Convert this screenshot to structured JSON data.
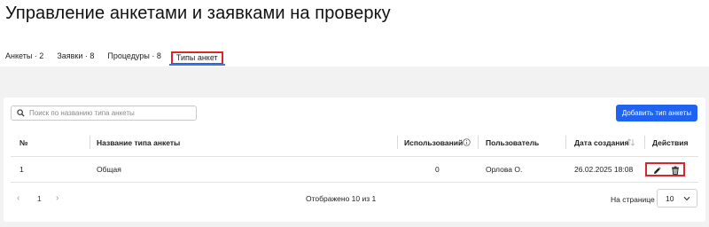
{
  "page": {
    "title": "Управление анкетами и заявками на проверку"
  },
  "tabs": [
    {
      "label": "Анкеты · 2",
      "active": false
    },
    {
      "label": "Заявки · 8",
      "active": false
    },
    {
      "label": "Процедуры · 8",
      "active": false
    },
    {
      "label": "Типы анкет",
      "active": true
    }
  ],
  "toolbar": {
    "search_placeholder": "Поиск по названию типа анкеты",
    "search_value": "",
    "add_button_label": "Добавить тип анкеты"
  },
  "table": {
    "columns": [
      "№",
      "Название типа анкеты",
      "Использований",
      "Пользователь",
      "Дата создания",
      "Действия"
    ],
    "info_icon": "info-circle-icon",
    "sort_icon": "sort-icon",
    "rows": [
      {
        "num": "1",
        "name": "Общая",
        "usages": "0",
        "user": "Орлова О.",
        "created": "26.02.2025 18:08"
      }
    ],
    "row_actions": [
      "pencil-icon",
      "trash-icon"
    ]
  },
  "pagination": {
    "prev": "‹",
    "page": "1",
    "next": "›",
    "shown_text": "Отображено 10 из 1",
    "per_page_label": "На странице",
    "per_page_value": "10"
  },
  "colors": {
    "accent": "#1f63f0",
    "highlight": "#d8262d",
    "tab_underline": "#3a75f0",
    "background_gray": "#f2f2f2"
  }
}
